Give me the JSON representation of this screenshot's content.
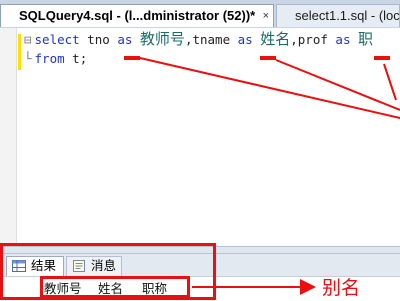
{
  "tabs": [
    {
      "label": "SQLQuery4.sql - (l...dministrator (52))*",
      "close": "×"
    },
    {
      "label": "select1.1.sql - (loc..."
    }
  ],
  "editor": {
    "line1": {
      "kw_select": "select",
      "col_tno": "tno",
      "kw_as1": "as",
      "alias_tno": "教师号",
      "comma1": ",",
      "col_tname": "tname",
      "kw_as2": "as",
      "alias_tname": "姓名",
      "comma2": ",",
      "col_prof": "prof",
      "kw_as3": "as",
      "alias_prof": "职"
    },
    "line2": {
      "kw_from": "from",
      "table": "t;"
    }
  },
  "results": {
    "tab_results": "结果",
    "tab_messages": "消息",
    "columns": [
      "教师号",
      "姓名",
      "职称"
    ]
  },
  "annotation": {
    "alias_label": "别名"
  },
  "colors": {
    "annotation_red": "#e81010",
    "keyword_blue": "#2233cc"
  }
}
